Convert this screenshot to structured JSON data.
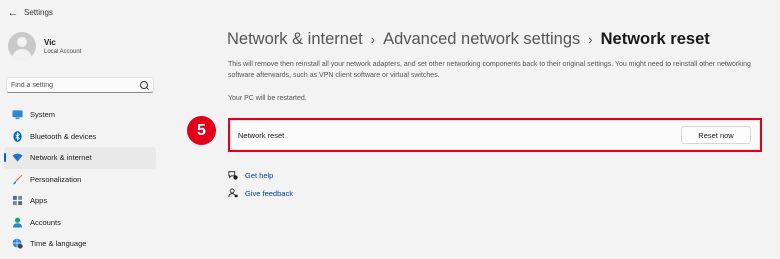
{
  "window": {
    "title": "Settings"
  },
  "user": {
    "name": "Vic",
    "account_type": "Local Account"
  },
  "search": {
    "placeholder": "Find a setting",
    "icon": "search-icon"
  },
  "nav": {
    "items": [
      {
        "label": "System",
        "icon": "system-icon",
        "color": "#2b88d8"
      },
      {
        "label": "Bluetooth & devices",
        "icon": "bluetooth-icon",
        "color": "#0067c0"
      },
      {
        "label": "Network & internet",
        "icon": "network-icon",
        "color": "#2b6fc9",
        "active": true
      },
      {
        "label": "Personalization",
        "icon": "brush-icon",
        "color": "#c07a3a"
      },
      {
        "label": "Apps",
        "icon": "apps-icon",
        "color": "#5b6b7c"
      },
      {
        "label": "Accounts",
        "icon": "accounts-icon",
        "color": "#1fa56a"
      },
      {
        "label": "Time & language",
        "icon": "globe-clock-icon",
        "color": "#2b88d8"
      }
    ]
  },
  "breadcrumb": {
    "items": [
      "Network & internet",
      "Advanced network settings",
      "Network reset"
    ],
    "separator": "›"
  },
  "page": {
    "description": "This will remove then reinstall all your network adapters, and set other networking components back to their original settings. You might need to reinstall other networking software afterwards, such as VPN client software or virtual switches.",
    "restart_note": "Your PC will be restarted.",
    "card_label": "Network reset",
    "reset_button": "Reset now",
    "step_number": "5"
  },
  "links": {
    "get_help": "Get help",
    "give_feedback": "Give feedback"
  },
  "colors": {
    "accent": "#0067c0",
    "highlight": "#e3001b",
    "link": "#003e92",
    "background": "#f3f3f3"
  }
}
